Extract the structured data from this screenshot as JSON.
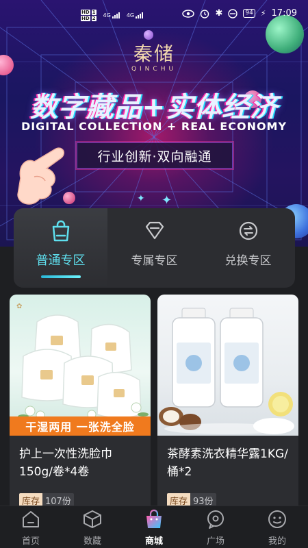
{
  "status_bar": {
    "network_top": "4G",
    "network_bottom": "4G",
    "battery": "94",
    "time": "17:09"
  },
  "banner": {
    "logo_cn": "秦储",
    "logo_en": "QINCHU",
    "headline": "数字藏品+实体经济",
    "subline": "DIGITAL COLLECTION + REAL ECONOMY",
    "slogan": "行业创新·双向融通"
  },
  "tabs": [
    {
      "label": "普通专区",
      "icon": "shopping-bag-icon",
      "active": true
    },
    {
      "label": "专属专区",
      "icon": "diamond-icon",
      "active": false
    },
    {
      "label": "兑换专区",
      "icon": "exchange-icon",
      "active": false
    }
  ],
  "products": [
    {
      "title": "护上一次性洗脸巾150g/卷*4卷",
      "promo": "干湿两用  一张洗全脸",
      "stock_label": "库存",
      "stock_value": "107份"
    },
    {
      "title": "茶酵素洗衣精华露1KG/桶*2",
      "stock_label": "库存",
      "stock_value": "93份"
    }
  ],
  "bottom_nav": [
    {
      "label": "首页",
      "icon": "home-icon",
      "active": false
    },
    {
      "label": "数藏",
      "icon": "cube-icon",
      "active": false
    },
    {
      "label": "商城",
      "icon": "shopping-bag-icon",
      "active": true
    },
    {
      "label": "广场",
      "icon": "chat-bubble-icon",
      "active": false
    },
    {
      "label": "我的",
      "icon": "smiley-icon",
      "active": false
    }
  ],
  "colors": {
    "accent": "#5fe0ef",
    "background": "#1e1f22",
    "card": "#2c2d31",
    "promo": "#f07a1e",
    "nav_active_start": "#ff5fb0",
    "nav_active_end": "#36c8ff"
  }
}
